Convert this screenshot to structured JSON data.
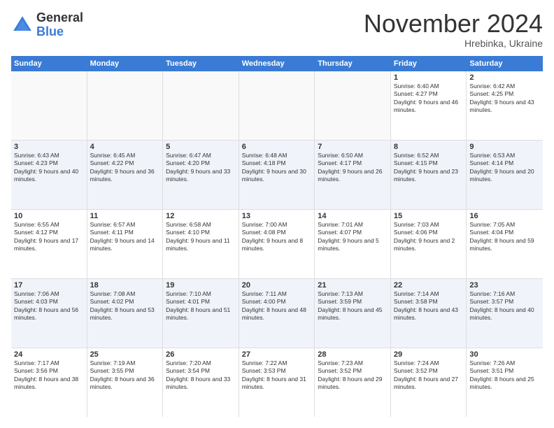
{
  "logo": {
    "general": "General",
    "blue": "Blue"
  },
  "title": "November 2024",
  "location": "Hrebinka, Ukraine",
  "days_header": [
    "Sunday",
    "Monday",
    "Tuesday",
    "Wednesday",
    "Thursday",
    "Friday",
    "Saturday"
  ],
  "rows": [
    {
      "alt": false,
      "cells": [
        {
          "day": "",
          "sunrise": "",
          "sunset": "",
          "daylight": "",
          "empty": true
        },
        {
          "day": "",
          "sunrise": "",
          "sunset": "",
          "daylight": "",
          "empty": true
        },
        {
          "day": "",
          "sunrise": "",
          "sunset": "",
          "daylight": "",
          "empty": true
        },
        {
          "day": "",
          "sunrise": "",
          "sunset": "",
          "daylight": "",
          "empty": true
        },
        {
          "day": "",
          "sunrise": "",
          "sunset": "",
          "daylight": "",
          "empty": true
        },
        {
          "day": "1",
          "sunrise": "Sunrise: 6:40 AM",
          "sunset": "Sunset: 4:27 PM",
          "daylight": "Daylight: 9 hours and 46 minutes.",
          "empty": false
        },
        {
          "day": "2",
          "sunrise": "Sunrise: 6:42 AM",
          "sunset": "Sunset: 4:25 PM",
          "daylight": "Daylight: 9 hours and 43 minutes.",
          "empty": false
        }
      ]
    },
    {
      "alt": true,
      "cells": [
        {
          "day": "3",
          "sunrise": "Sunrise: 6:43 AM",
          "sunset": "Sunset: 4:23 PM",
          "daylight": "Daylight: 9 hours and 40 minutes.",
          "empty": false
        },
        {
          "day": "4",
          "sunrise": "Sunrise: 6:45 AM",
          "sunset": "Sunset: 4:22 PM",
          "daylight": "Daylight: 9 hours and 36 minutes.",
          "empty": false
        },
        {
          "day": "5",
          "sunrise": "Sunrise: 6:47 AM",
          "sunset": "Sunset: 4:20 PM",
          "daylight": "Daylight: 9 hours and 33 minutes.",
          "empty": false
        },
        {
          "day": "6",
          "sunrise": "Sunrise: 6:48 AM",
          "sunset": "Sunset: 4:18 PM",
          "daylight": "Daylight: 9 hours and 30 minutes.",
          "empty": false
        },
        {
          "day": "7",
          "sunrise": "Sunrise: 6:50 AM",
          "sunset": "Sunset: 4:17 PM",
          "daylight": "Daylight: 9 hours and 26 minutes.",
          "empty": false
        },
        {
          "day": "8",
          "sunrise": "Sunrise: 6:52 AM",
          "sunset": "Sunset: 4:15 PM",
          "daylight": "Daylight: 9 hours and 23 minutes.",
          "empty": false
        },
        {
          "day": "9",
          "sunrise": "Sunrise: 6:53 AM",
          "sunset": "Sunset: 4:14 PM",
          "daylight": "Daylight: 9 hours and 20 minutes.",
          "empty": false
        }
      ]
    },
    {
      "alt": false,
      "cells": [
        {
          "day": "10",
          "sunrise": "Sunrise: 6:55 AM",
          "sunset": "Sunset: 4:12 PM",
          "daylight": "Daylight: 9 hours and 17 minutes.",
          "empty": false
        },
        {
          "day": "11",
          "sunrise": "Sunrise: 6:57 AM",
          "sunset": "Sunset: 4:11 PM",
          "daylight": "Daylight: 9 hours and 14 minutes.",
          "empty": false
        },
        {
          "day": "12",
          "sunrise": "Sunrise: 6:58 AM",
          "sunset": "Sunset: 4:10 PM",
          "daylight": "Daylight: 9 hours and 11 minutes.",
          "empty": false
        },
        {
          "day": "13",
          "sunrise": "Sunrise: 7:00 AM",
          "sunset": "Sunset: 4:08 PM",
          "daylight": "Daylight: 9 hours and 8 minutes.",
          "empty": false
        },
        {
          "day": "14",
          "sunrise": "Sunrise: 7:01 AM",
          "sunset": "Sunset: 4:07 PM",
          "daylight": "Daylight: 9 hours and 5 minutes.",
          "empty": false
        },
        {
          "day": "15",
          "sunrise": "Sunrise: 7:03 AM",
          "sunset": "Sunset: 4:06 PM",
          "daylight": "Daylight: 9 hours and 2 minutes.",
          "empty": false
        },
        {
          "day": "16",
          "sunrise": "Sunrise: 7:05 AM",
          "sunset": "Sunset: 4:04 PM",
          "daylight": "Daylight: 8 hours and 59 minutes.",
          "empty": false
        }
      ]
    },
    {
      "alt": true,
      "cells": [
        {
          "day": "17",
          "sunrise": "Sunrise: 7:06 AM",
          "sunset": "Sunset: 4:03 PM",
          "daylight": "Daylight: 8 hours and 56 minutes.",
          "empty": false
        },
        {
          "day": "18",
          "sunrise": "Sunrise: 7:08 AM",
          "sunset": "Sunset: 4:02 PM",
          "daylight": "Daylight: 8 hours and 53 minutes.",
          "empty": false
        },
        {
          "day": "19",
          "sunrise": "Sunrise: 7:10 AM",
          "sunset": "Sunset: 4:01 PM",
          "daylight": "Daylight: 8 hours and 51 minutes.",
          "empty": false
        },
        {
          "day": "20",
          "sunrise": "Sunrise: 7:11 AM",
          "sunset": "Sunset: 4:00 PM",
          "daylight": "Daylight: 8 hours and 48 minutes.",
          "empty": false
        },
        {
          "day": "21",
          "sunrise": "Sunrise: 7:13 AM",
          "sunset": "Sunset: 3:59 PM",
          "daylight": "Daylight: 8 hours and 45 minutes.",
          "empty": false
        },
        {
          "day": "22",
          "sunrise": "Sunrise: 7:14 AM",
          "sunset": "Sunset: 3:58 PM",
          "daylight": "Daylight: 8 hours and 43 minutes.",
          "empty": false
        },
        {
          "day": "23",
          "sunrise": "Sunrise: 7:16 AM",
          "sunset": "Sunset: 3:57 PM",
          "daylight": "Daylight: 8 hours and 40 minutes.",
          "empty": false
        }
      ]
    },
    {
      "alt": false,
      "cells": [
        {
          "day": "24",
          "sunrise": "Sunrise: 7:17 AM",
          "sunset": "Sunset: 3:56 PM",
          "daylight": "Daylight: 8 hours and 38 minutes.",
          "empty": false
        },
        {
          "day": "25",
          "sunrise": "Sunrise: 7:19 AM",
          "sunset": "Sunset: 3:55 PM",
          "daylight": "Daylight: 8 hours and 36 minutes.",
          "empty": false
        },
        {
          "day": "26",
          "sunrise": "Sunrise: 7:20 AM",
          "sunset": "Sunset: 3:54 PM",
          "daylight": "Daylight: 8 hours and 33 minutes.",
          "empty": false
        },
        {
          "day": "27",
          "sunrise": "Sunrise: 7:22 AM",
          "sunset": "Sunset: 3:53 PM",
          "daylight": "Daylight: 8 hours and 31 minutes.",
          "empty": false
        },
        {
          "day": "28",
          "sunrise": "Sunrise: 7:23 AM",
          "sunset": "Sunset: 3:52 PM",
          "daylight": "Daylight: 8 hours and 29 minutes.",
          "empty": false
        },
        {
          "day": "29",
          "sunrise": "Sunrise: 7:24 AM",
          "sunset": "Sunset: 3:52 PM",
          "daylight": "Daylight: 8 hours and 27 minutes.",
          "empty": false
        },
        {
          "day": "30",
          "sunrise": "Sunrise: 7:26 AM",
          "sunset": "Sunset: 3:51 PM",
          "daylight": "Daylight: 8 hours and 25 minutes.",
          "empty": false
        }
      ]
    }
  ]
}
